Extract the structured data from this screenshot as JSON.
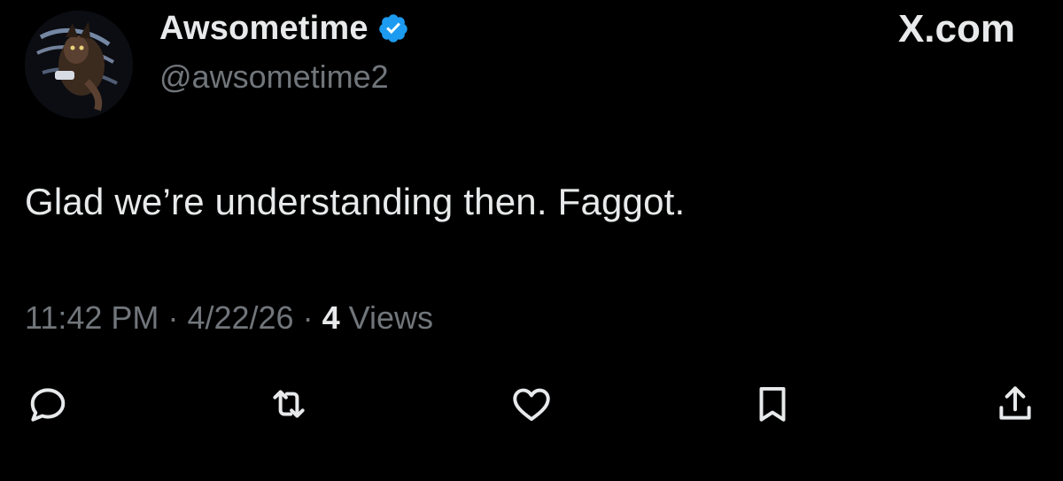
{
  "author": {
    "display_name": "Awsometime",
    "handle": "@awsometime2",
    "verified": true,
    "avatar_icon": "avatar-illustration-icon"
  },
  "brand": {
    "label": "X.com"
  },
  "tweet": {
    "text": "Glad we’re understanding then. Faggot.",
    "time": "11:42 PM",
    "separator": "·",
    "date": "4/22/26",
    "views_count": "4",
    "views_label": "Views"
  },
  "actions": [
    {
      "name": "reply",
      "icon": "reply-icon"
    },
    {
      "name": "repost",
      "icon": "repost-icon"
    },
    {
      "name": "like",
      "icon": "heart-icon"
    },
    {
      "name": "bookmark",
      "icon": "bookmark-icon"
    },
    {
      "name": "share",
      "icon": "share-icon"
    }
  ],
  "colors": {
    "background": "#000000",
    "primary_text": "#e7e9ea",
    "secondary_text": "#71767b",
    "verified_badge": "#1d9bf0"
  }
}
